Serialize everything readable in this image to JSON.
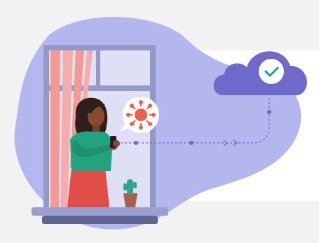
{
  "scene": {
    "background": "#f2f2f2",
    "card_color": "#ffffff",
    "blob_color": "#b3b7ee",
    "icons": [
      "virus-icon",
      "checkmark-icon",
      "cloud-icon",
      "phone-icon",
      "cactus-icon"
    ]
  },
  "colors": {
    "cloud": "#6f69c9",
    "check": "#2fa58f",
    "virus": "#e8614b",
    "window_frame": "#9599c8",
    "window_glass": "#dfe0f6",
    "curtain": "#f19a96",
    "shirt": "#23a37d",
    "skirt": "#e14d47",
    "skin": "#8a4a32",
    "hair": "#2f1e1c",
    "dashed_line": "#6f69c9"
  }
}
